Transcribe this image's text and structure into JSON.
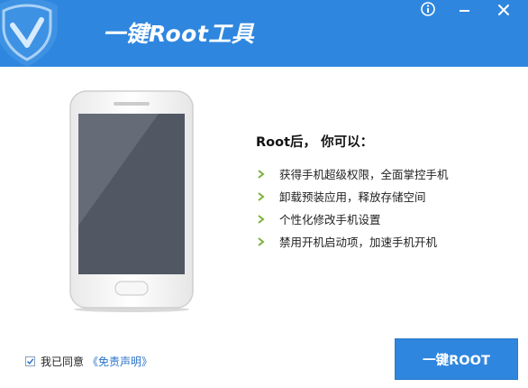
{
  "window": {
    "title": "一键Root工具",
    "icons": [
      "shield-logo-icon",
      "info-icon",
      "minimize-icon",
      "close-icon"
    ],
    "colors": {
      "header": "#2f86de",
      "accent_green": "#7bb33a",
      "link": "#2a74c9"
    }
  },
  "main": {
    "heading": "Root后， 你可以：",
    "features": [
      {
        "text": "获得手机超级权限，全面掌控手机"
      },
      {
        "text": "卸载预装应用，释放存储空间"
      },
      {
        "text": "个性化修改手机设置"
      },
      {
        "text": "禁用开机启动项，加速手机开机"
      }
    ]
  },
  "footer": {
    "agree_checked": true,
    "agree_label": "我已同意",
    "disclaimer_link": "《免责声明》",
    "root_button": "一键ROOT"
  }
}
